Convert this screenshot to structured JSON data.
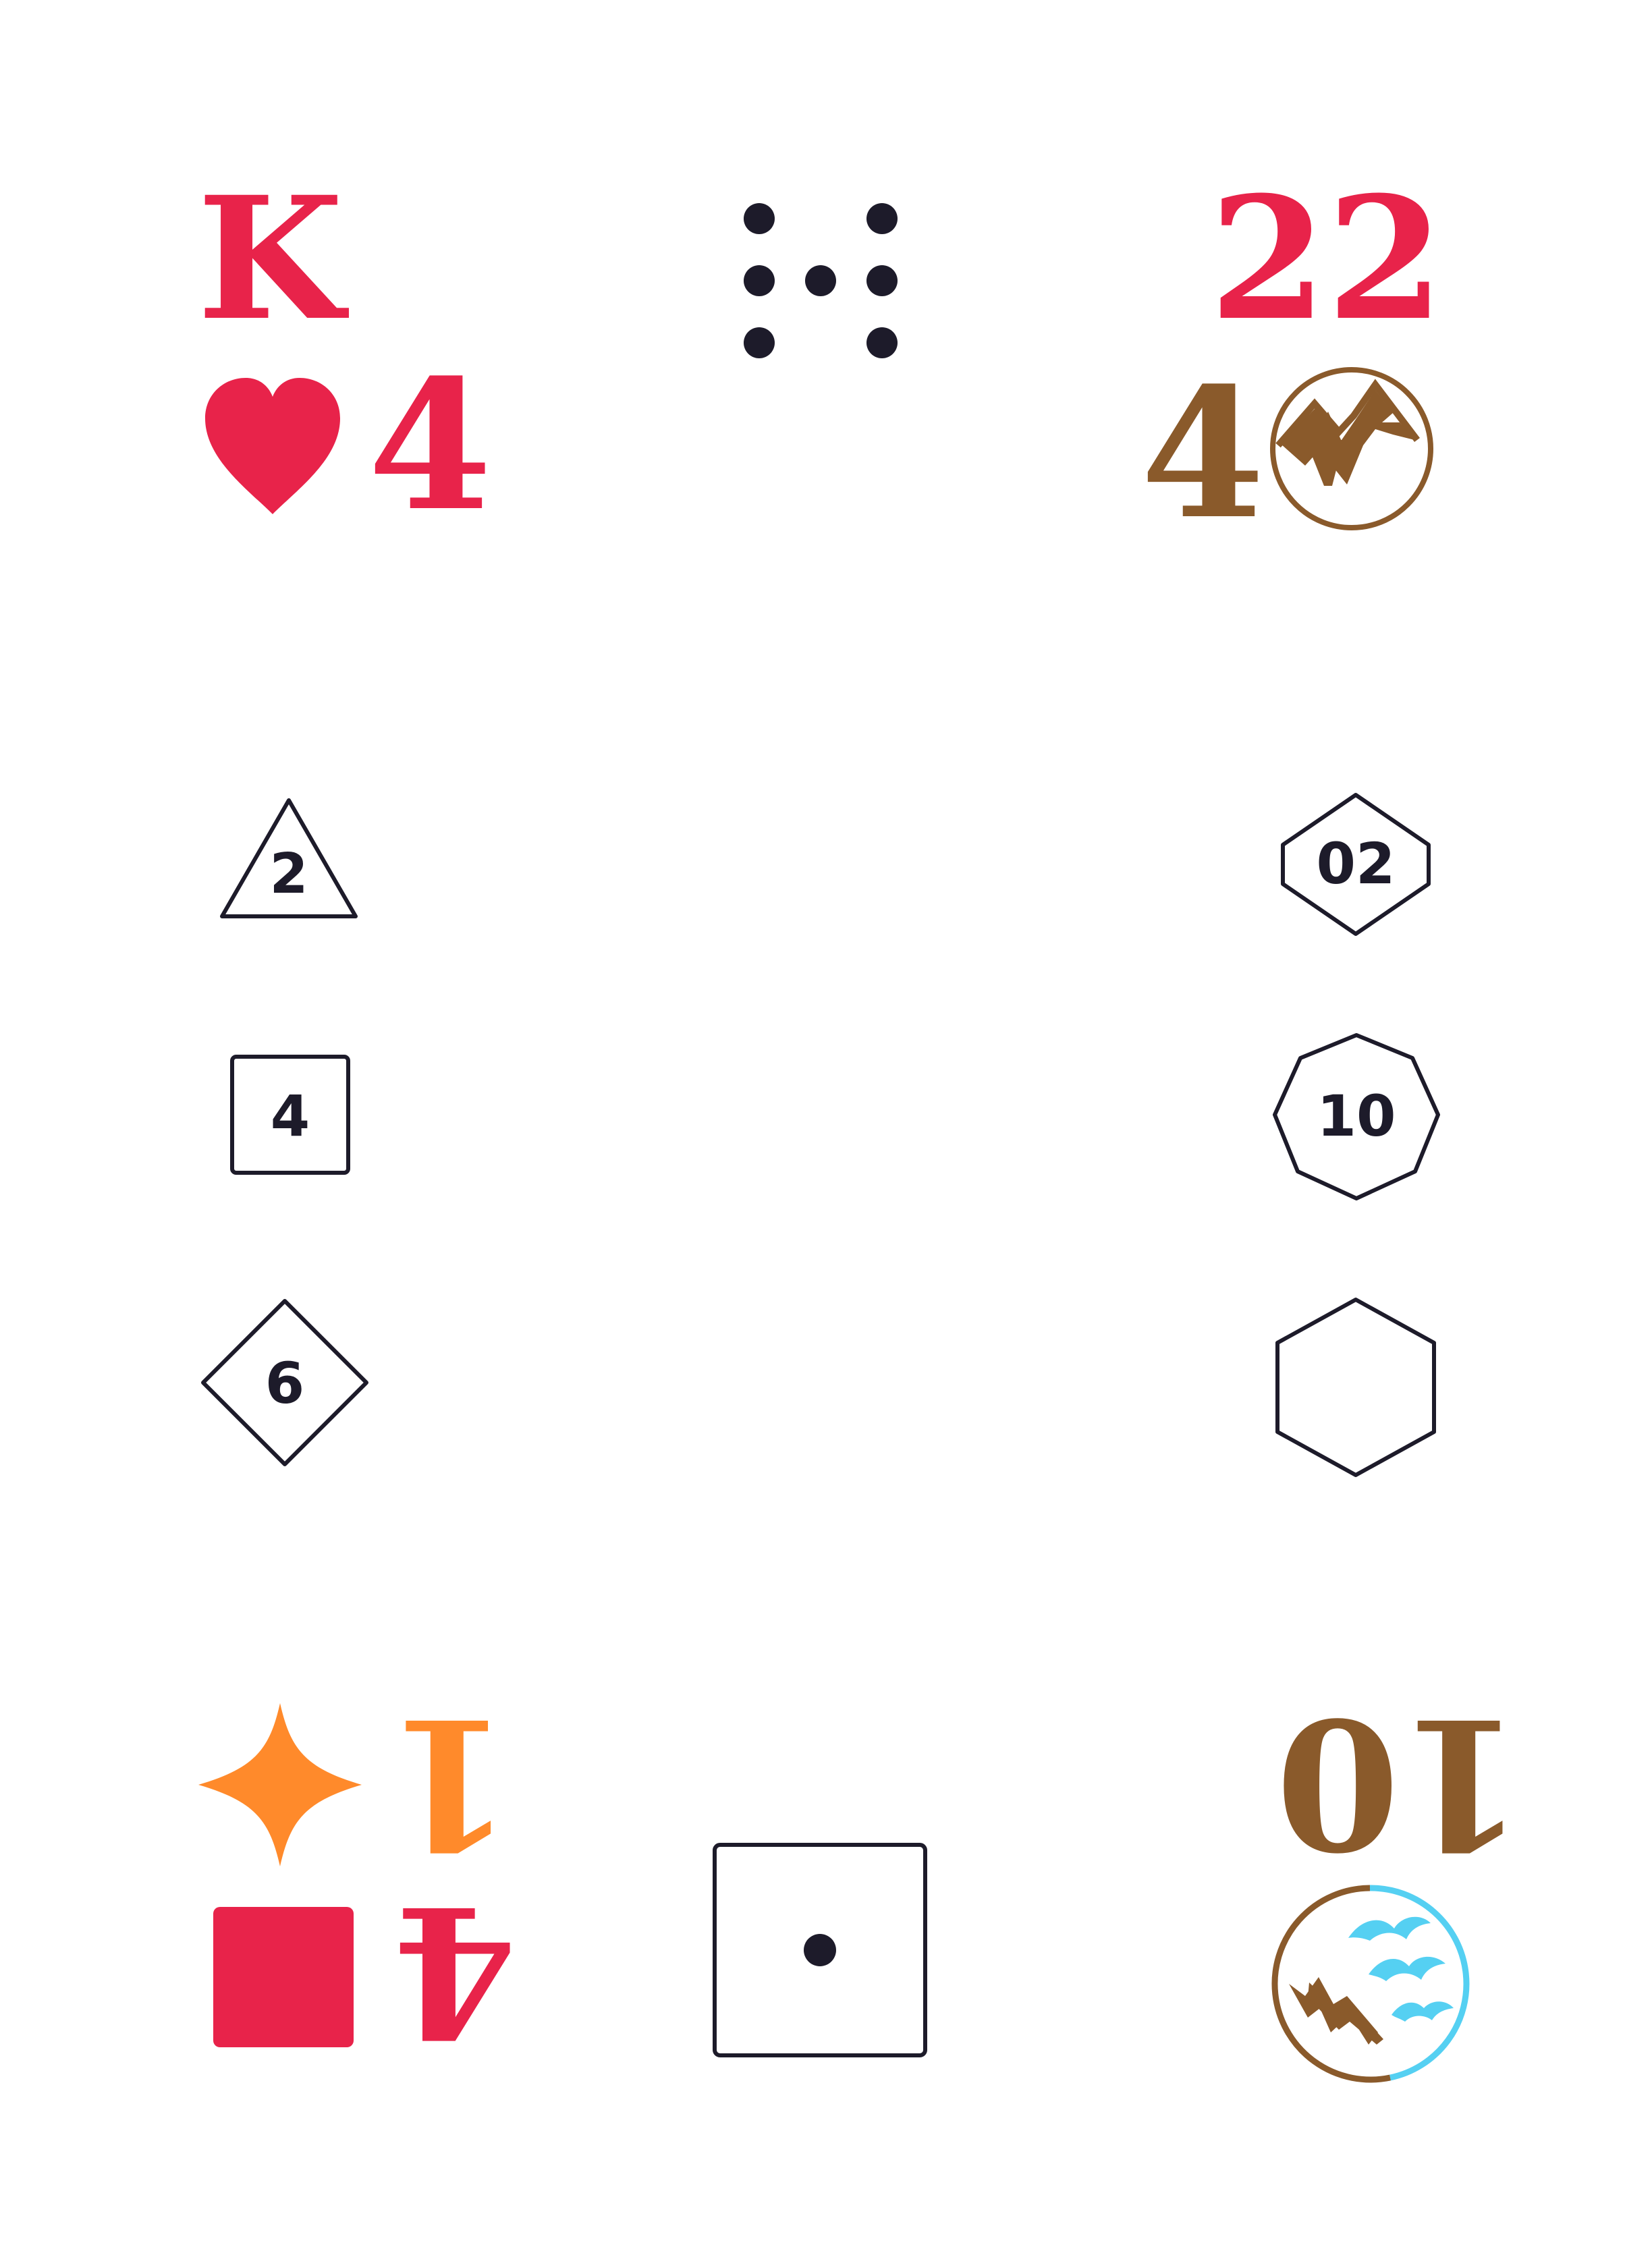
{
  "colors": {
    "red": "#e8234a",
    "brown": "#8a5a2b",
    "orange": "#ff8a2b",
    "sky": "#55d0f2",
    "ink": "#1d1b2a"
  },
  "top_left": {
    "rank": "K",
    "suit_icon": "heart-icon",
    "suit_value": "4"
  },
  "top_center": {
    "pips_icon": "seven-dot-pips-icon"
  },
  "top_right": {
    "score": "22",
    "terrain_value": "4",
    "terrain_icon": "mountain-badge-icon"
  },
  "dice_left": [
    {
      "shape": "triangle",
      "label": "2"
    },
    {
      "shape": "square",
      "label": "4"
    },
    {
      "shape": "diamond",
      "label": "6"
    }
  ],
  "dice_right": [
    {
      "shape": "hexagon-pointy",
      "label": "02"
    },
    {
      "shape": "octagon",
      "label": "10"
    },
    {
      "shape": "hexagon-tall",
      "label": ""
    }
  ],
  "bottom_left": {
    "star_icon": "four-point-star-icon",
    "star_value": "1",
    "square_icon": "square-suit-icon",
    "square_value": "4"
  },
  "bottom_center": {
    "die_icon": "one-pip-die-icon"
  },
  "bottom_right": {
    "score": "10",
    "terrain_icon": "mountain-sky-badge-icon"
  }
}
